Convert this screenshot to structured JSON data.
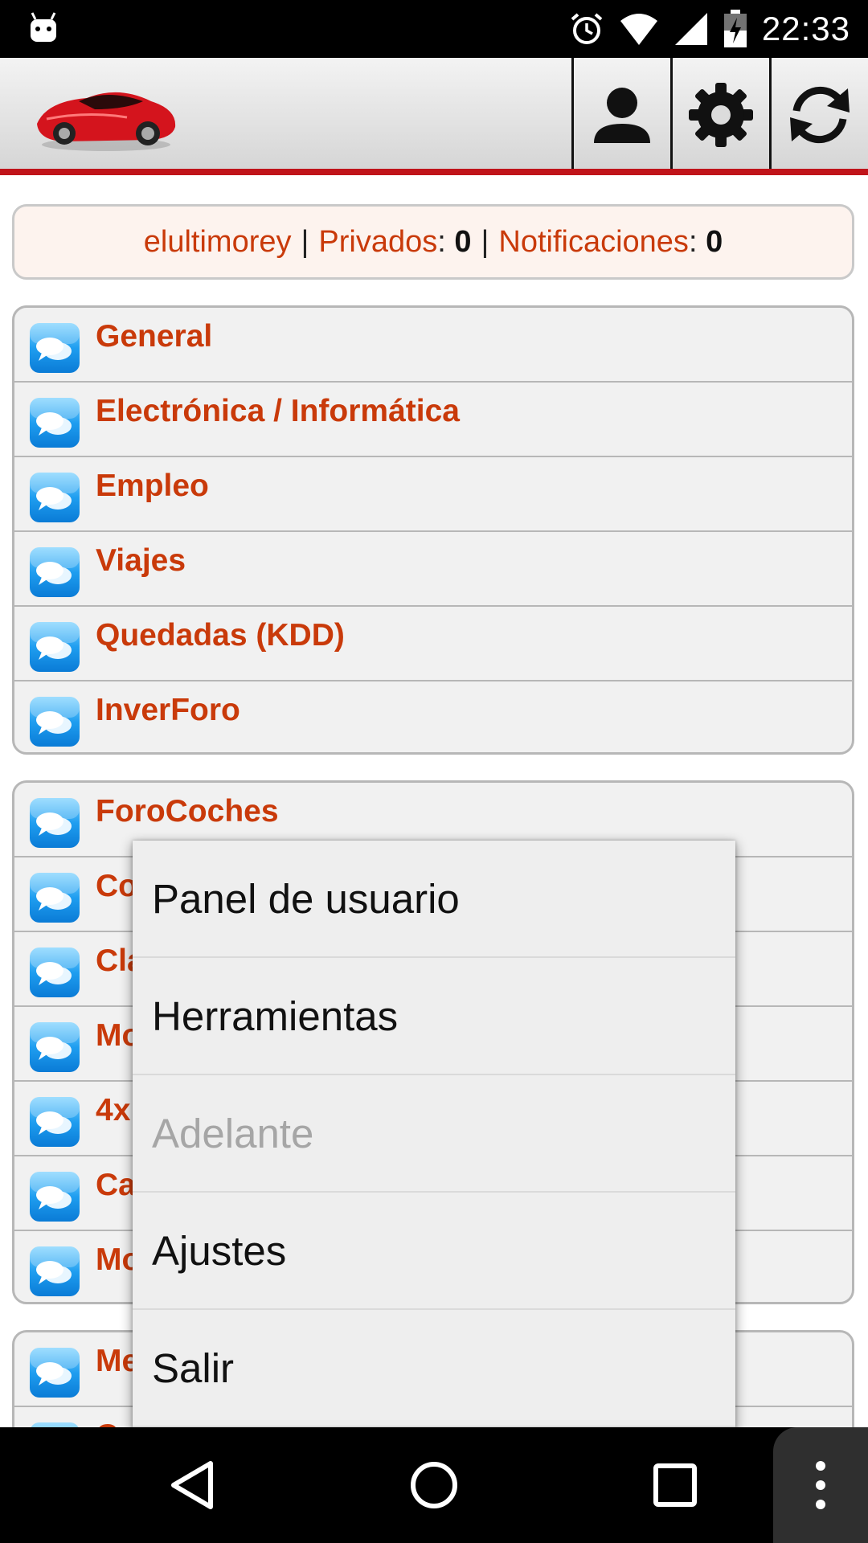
{
  "status_bar": {
    "time": "22:33"
  },
  "header": {
    "logo_name": "car-logo",
    "buttons": [
      {
        "icon": "user-icon"
      },
      {
        "icon": "gear-icon"
      },
      {
        "icon": "refresh-icon"
      }
    ]
  },
  "info": {
    "username": "elultimorey",
    "separator": "|",
    "privados_label": "Privados",
    "privados_value": "0",
    "notificaciones_label": "Notificaciones",
    "notificaciones_value": "0"
  },
  "group1": {
    "items": [
      {
        "label": "General"
      },
      {
        "label": "Electrónica / Informática"
      },
      {
        "label": "Empleo"
      },
      {
        "label": "Viajes"
      },
      {
        "label": "Quedadas (KDD)"
      },
      {
        "label": "InverForo"
      }
    ]
  },
  "group2": {
    "items": [
      {
        "label": "ForoCoches"
      },
      {
        "label": "Co"
      },
      {
        "label": "Cla"
      },
      {
        "label": "Mo"
      },
      {
        "label": "4x"
      },
      {
        "label": "Ca"
      },
      {
        "label": "Mo"
      }
    ]
  },
  "group3": {
    "items": [
      {
        "label": "Me"
      },
      {
        "label": "C"
      }
    ]
  },
  "menu": {
    "items": [
      {
        "label": "Panel de usuario",
        "enabled": true
      },
      {
        "label": "Herramientas",
        "enabled": true
      },
      {
        "label": "Adelante",
        "enabled": false
      },
      {
        "label": "Ajustes",
        "enabled": true
      },
      {
        "label": "Salir",
        "enabled": true
      }
    ]
  },
  "colors": {
    "accent": "#c93a0a",
    "header_line": "#c0141a"
  }
}
